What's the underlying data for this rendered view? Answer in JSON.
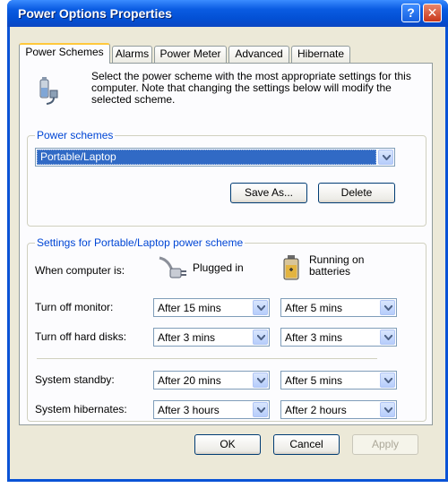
{
  "window": {
    "title": "Power Options Properties"
  },
  "tabs": [
    {
      "label": "Power Schemes",
      "active": true
    },
    {
      "label": "Alarms"
    },
    {
      "label": "Power Meter"
    },
    {
      "label": "Advanced"
    },
    {
      "label": "Hibernate"
    }
  ],
  "intro": "Select the power scheme with the most appropriate settings for this computer. Note that changing the settings below will modify the selected scheme.",
  "schemes": {
    "legend": "Power schemes",
    "selected": "Portable/Laptop",
    "save_as_label": "Save As...",
    "delete_label": "Delete"
  },
  "settings": {
    "legend": "Settings for Portable/Laptop power scheme",
    "when_label": "When computer is:",
    "plugged_in": "Plugged in",
    "on_batteries": "Running on batteries",
    "rows": [
      {
        "label": "Turn off monitor:",
        "plugged": "After 15 mins",
        "battery": "After 5 mins"
      },
      {
        "label": "Turn off hard disks:",
        "plugged": "After 3 mins",
        "battery": "After 3 mins"
      },
      {
        "label": "System standby:",
        "plugged": "After 20 mins",
        "battery": "After 5 mins"
      },
      {
        "label": "System hibernates:",
        "plugged": "After 3 hours",
        "battery": "After 2 hours"
      }
    ]
  },
  "buttons": {
    "ok": "OK",
    "cancel": "Cancel",
    "apply": "Apply"
  },
  "colors": {
    "title_bar": "#0a5be2",
    "group_label": "#0046d5",
    "selection": "#316ac5",
    "client_bg": "#ece9d8"
  }
}
